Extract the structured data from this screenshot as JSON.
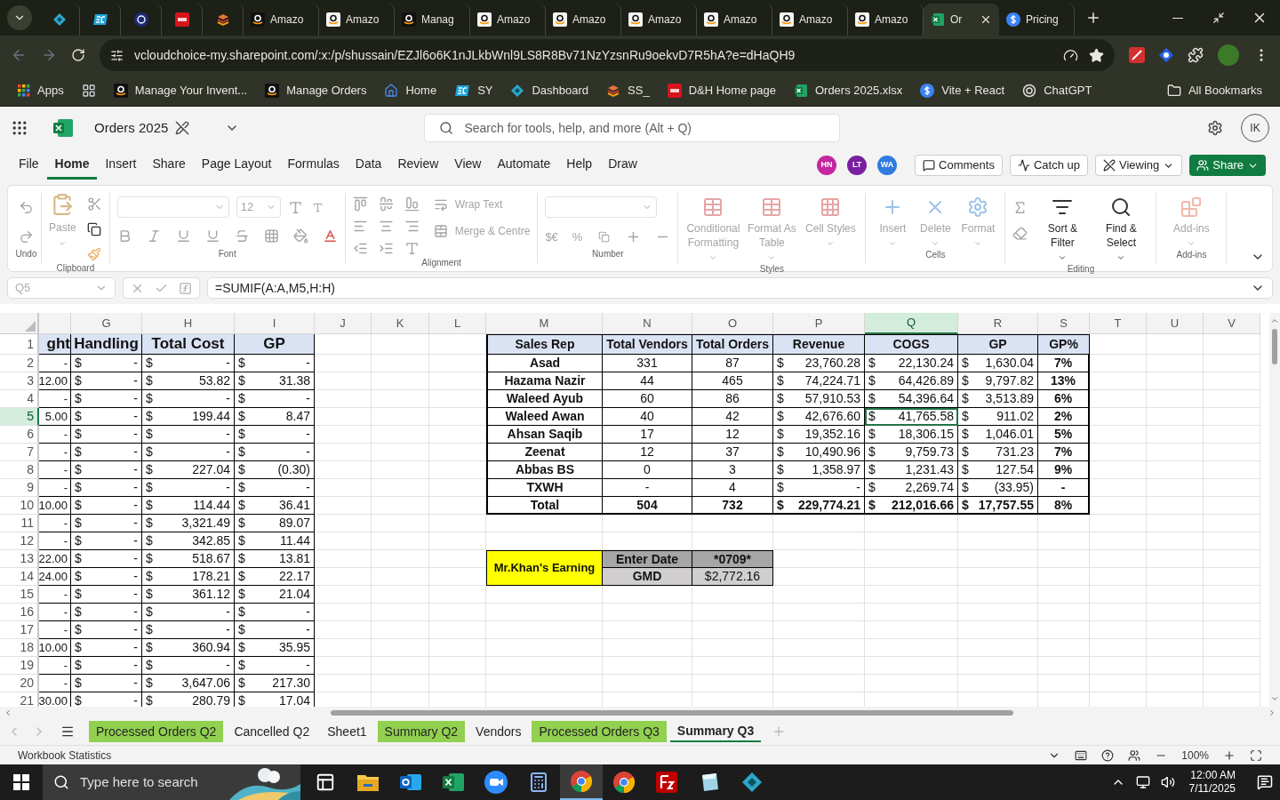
{
  "browser": {
    "tabs": [
      {
        "kind": "diamond",
        "selected": false
      },
      {
        "kind": "ec",
        "selected": false
      },
      {
        "kind": "tu",
        "selected": false
      },
      {
        "kind": "dh",
        "selected": false
      },
      {
        "kind": "stack",
        "selected": false
      },
      {
        "kind": "amazon",
        "label": "Amazo",
        "selected": false
      },
      {
        "kind": "amazon-light",
        "label": "Amazo",
        "selected": false
      },
      {
        "kind": "amazon",
        "label": "Manag",
        "selected": false
      },
      {
        "kind": "amazon-light",
        "label": "Amazo",
        "selected": false
      },
      {
        "kind": "amazon-light",
        "label": "Amazo",
        "selected": false
      },
      {
        "kind": "amazon-light",
        "label": "Amazo",
        "selected": false
      },
      {
        "kind": "amazon-light",
        "label": "Amazo",
        "selected": false
      },
      {
        "kind": "amazon-light",
        "label": "Amazo",
        "selected": false
      },
      {
        "kind": "amazon-light",
        "label": "Amazo",
        "selected": false
      },
      {
        "kind": "excel",
        "label": "Or",
        "selected": true
      },
      {
        "kind": "dollar",
        "label": "Pricing",
        "selected": false
      }
    ],
    "url": "vcloudchoice-my.sharepoint.com/:x:/p/shussain/EZJl6o6K1nJLkbWnl9LS8R8Bv71NzYzsnRu9oekvD7R5hA?e=dHaQH9",
    "bookmarks": [
      {
        "kind": "apps",
        "label": "Apps"
      },
      {
        "kind": "grid"
      },
      {
        "kind": "amazon",
        "label": "Manage Your Invent..."
      },
      {
        "kind": "amazon",
        "label": "Manage Orders"
      },
      {
        "kind": "home",
        "label": "Home"
      },
      {
        "kind": "ec",
        "label": "SY"
      },
      {
        "kind": "diamond",
        "label": "Dashboard"
      },
      {
        "kind": "stack",
        "label": "SS_"
      },
      {
        "kind": "dh",
        "label": "D&H Home page"
      },
      {
        "kind": "excel",
        "label": "Orders 2025.xlsx"
      },
      {
        "kind": "dollar",
        "label": "Vite + React"
      },
      {
        "kind": "chatgpt",
        "label": "ChatGPT"
      }
    ],
    "all_bookmarks": "All Bookmarks"
  },
  "excel": {
    "file_name": "Orders 2025",
    "search_placeholder": "Search for tools, help, and more (Alt + Q)",
    "user_initials": "IK",
    "menu": [
      {
        "label": "File",
        "selected": false
      },
      {
        "label": "Home",
        "selected": true
      },
      {
        "label": "Insert",
        "selected": false
      },
      {
        "label": "Share",
        "selected": false
      },
      {
        "label": "Page Layout",
        "selected": false
      },
      {
        "label": "Formulas",
        "selected": false
      },
      {
        "label": "Data",
        "selected": false
      },
      {
        "label": "Review",
        "selected": false
      },
      {
        "label": "View",
        "selected": false
      },
      {
        "label": "Automate",
        "selected": false
      },
      {
        "label": "Help",
        "selected": false
      },
      {
        "label": "Draw",
        "selected": false
      }
    ],
    "collaborators": [
      {
        "initials": "HN",
        "color": "#c4269f"
      },
      {
        "initials": "LT",
        "color": "#7a1fa2"
      },
      {
        "initials": "WA",
        "color": "#2f7be0"
      }
    ],
    "actions": {
      "comments": "Comments",
      "catch_up": "Catch up",
      "viewing": "Viewing",
      "share": "Share"
    },
    "ribbon": [
      {
        "kind": "undo",
        "label": "Undo"
      },
      {
        "kind": "clipboard",
        "label": "Clipboard",
        "commands": [
          {
            "label": "Paste",
            "disabled": true
          }
        ]
      },
      {
        "kind": "font",
        "label": "Font",
        "font_size": "12"
      },
      {
        "kind": "alignment",
        "label": "Alignment",
        "commands": [
          {
            "label": "Wrap Text",
            "disabled": true
          },
          {
            "label": "Merge & Centre",
            "disabled": true
          }
        ]
      },
      {
        "kind": "number",
        "label": "Number",
        "commands": [
          {
            "label": "$€",
            "disabled": true
          },
          {
            "label": "%",
            "disabled": true
          }
        ]
      },
      {
        "kind": "styles",
        "label": "Styles",
        "commands": [
          {
            "label": "Conditional Formatting",
            "disabled": true
          },
          {
            "label": "Format As Table",
            "disabled": true
          },
          {
            "label": "Cell Styles",
            "disabled": true
          }
        ]
      },
      {
        "kind": "cells",
        "label": "Cells",
        "commands": [
          {
            "label": "Insert",
            "disabled": true
          },
          {
            "label": "Delete",
            "disabled": true
          },
          {
            "label": "Format",
            "disabled": true
          }
        ]
      },
      {
        "kind": "editing",
        "label": "Editing",
        "commands": [
          {
            "label": "Sort & Filter",
            "disabled": false
          },
          {
            "label": "Find & Select",
            "disabled": false
          }
        ]
      },
      {
        "kind": "addins",
        "label": "Add-ins",
        "commands": [
          {
            "label": "Add-ins",
            "disabled": true
          }
        ]
      }
    ],
    "name_box": "Q5",
    "formula": "=SUMIF(A:A,M5,H:H)"
  },
  "grid": {
    "columns": [
      {
        "label": "G",
        "selected": false
      },
      {
        "label": "H",
        "selected": false
      },
      {
        "label": "I",
        "selected": false
      },
      {
        "label": "J",
        "selected": false
      },
      {
        "label": "K",
        "selected": false
      },
      {
        "label": "L",
        "selected": false
      },
      {
        "label": "M",
        "selected": false
      },
      {
        "label": "N",
        "selected": false
      },
      {
        "label": "O",
        "selected": false
      },
      {
        "label": "P",
        "selected": false
      },
      {
        "label": "Q",
        "selected": true
      },
      {
        "label": "R",
        "selected": false
      },
      {
        "label": "S",
        "selected": false
      },
      {
        "label": "T",
        "selected": false
      },
      {
        "label": "U",
        "selected": false
      },
      {
        "label": "V",
        "selected": false
      }
    ],
    "rows": [
      {
        "label": "1",
        "selected": false
      },
      {
        "label": "2",
        "selected": false
      },
      {
        "label": "3",
        "selected": false
      },
      {
        "label": "4",
        "selected": false
      },
      {
        "label": "5",
        "selected": true
      },
      {
        "label": "6",
        "selected": false
      },
      {
        "label": "7",
        "selected": false
      },
      {
        "label": "8",
        "selected": false
      },
      {
        "label": "9",
        "selected": false
      },
      {
        "label": "10",
        "selected": false
      },
      {
        "label": "11",
        "selected": false
      },
      {
        "label": "12",
        "selected": false
      },
      {
        "label": "13",
        "selected": false
      },
      {
        "label": "14",
        "selected": false
      },
      {
        "label": "15",
        "selected": false
      },
      {
        "label": "16",
        "selected": false
      },
      {
        "label": "17",
        "selected": false
      },
      {
        "label": "18",
        "selected": false
      },
      {
        "label": "19",
        "selected": false
      },
      {
        "label": "20",
        "selected": false
      },
      {
        "label": "21",
        "selected": false
      }
    ]
  },
  "cost_table": {
    "header": [
      "ght",
      "Handling",
      "Total Cost",
      "GP"
    ],
    "rows": [
      [
        {
          "v": "-"
        },
        {
          "s": "$",
          "v": "-"
        },
        {
          "s": "$",
          "v": "-"
        },
        {
          "s": "$",
          "v": "-"
        }
      ],
      [
        {
          "v": "12.00"
        },
        {
          "s": "$",
          "v": "-"
        },
        {
          "s": "$",
          "v": "53.82"
        },
        {
          "s": "$",
          "v": "31.38"
        }
      ],
      [
        {
          "v": "-"
        },
        {
          "s": "$",
          "v": "-"
        },
        {
          "s": "$",
          "v": "-"
        },
        {
          "s": "$",
          "v": "-"
        }
      ],
      [
        {
          "v": "5.00"
        },
        {
          "s": "$",
          "v": "-"
        },
        {
          "s": "$",
          "v": "199.44"
        },
        {
          "s": "$",
          "v": "8.47"
        }
      ],
      [
        {
          "v": "-"
        },
        {
          "s": "$",
          "v": "-"
        },
        {
          "s": "$",
          "v": "-"
        },
        {
          "s": "$",
          "v": "-"
        }
      ],
      [
        {
          "v": "-"
        },
        {
          "s": "$",
          "v": "-"
        },
        {
          "s": "$",
          "v": "-"
        },
        {
          "s": "$",
          "v": "-"
        }
      ],
      [
        {
          "v": "-"
        },
        {
          "s": "$",
          "v": "-"
        },
        {
          "s": "$",
          "v": "227.04"
        },
        {
          "s": "$",
          "v": "(0.30)"
        }
      ],
      [
        {
          "v": "-"
        },
        {
          "s": "$",
          "v": "-"
        },
        {
          "s": "$",
          "v": "-"
        },
        {
          "s": "$",
          "v": "-"
        }
      ],
      [
        {
          "v": "10.00"
        },
        {
          "s": "$",
          "v": "-"
        },
        {
          "s": "$",
          "v": "114.44"
        },
        {
          "s": "$",
          "v": "36.41"
        }
      ],
      [
        {
          "v": "-"
        },
        {
          "s": "$",
          "v": "-"
        },
        {
          "s": "$",
          "v": "3,321.49"
        },
        {
          "s": "$",
          "v": "89.07"
        }
      ],
      [
        {
          "v": "-"
        },
        {
          "s": "$",
          "v": "-"
        },
        {
          "s": "$",
          "v": "342.85"
        },
        {
          "s": "$",
          "v": "11.44"
        }
      ],
      [
        {
          "v": "22.00"
        },
        {
          "s": "$",
          "v": "-"
        },
        {
          "s": "$",
          "v": "518.67"
        },
        {
          "s": "$",
          "v": "13.81"
        }
      ],
      [
        {
          "v": "24.00"
        },
        {
          "s": "$",
          "v": "-"
        },
        {
          "s": "$",
          "v": "178.21"
        },
        {
          "s": "$",
          "v": "22.17"
        }
      ],
      [
        {
          "v": "-"
        },
        {
          "s": "$",
          "v": "-"
        },
        {
          "s": "$",
          "v": "361.12"
        },
        {
          "s": "$",
          "v": "21.04"
        }
      ],
      [
        {
          "v": "-"
        },
        {
          "s": "$",
          "v": "-"
        },
        {
          "s": "$",
          "v": "-"
        },
        {
          "s": "$",
          "v": "-"
        }
      ],
      [
        {
          "v": "-"
        },
        {
          "s": "$",
          "v": "-"
        },
        {
          "s": "$",
          "v": "-"
        },
        {
          "s": "$",
          "v": "-"
        }
      ],
      [
        {
          "v": "10.00"
        },
        {
          "s": "$",
          "v": "-"
        },
        {
          "s": "$",
          "v": "360.94"
        },
        {
          "s": "$",
          "v": "35.95"
        }
      ],
      [
        {
          "v": "-"
        },
        {
          "s": "$",
          "v": "-"
        },
        {
          "s": "$",
          "v": "-"
        },
        {
          "s": "$",
          "v": "-"
        }
      ],
      [
        {
          "v": "-"
        },
        {
          "s": "$",
          "v": "-"
        },
        {
          "s": "$",
          "v": "3,647.06"
        },
        {
          "s": "$",
          "v": "217.30"
        }
      ],
      [
        {
          "v": "30.00"
        },
        {
          "s": "$",
          "v": "-"
        },
        {
          "s": "$",
          "v": "280.79"
        },
        {
          "s": "$",
          "v": "17.04"
        }
      ]
    ]
  },
  "summary_table": {
    "header": [
      "Sales Rep",
      "Total Vendors",
      "Total Orders",
      "Revenue",
      "COGS",
      "GP",
      "GP%"
    ],
    "rows": [
      {
        "kind": "rep",
        "cells": [
          {
            "v": "Asad"
          },
          {
            "v": "331"
          },
          {
            "v": "87"
          },
          {
            "s": "$",
            "v": "23,760.28"
          },
          {
            "s": "$",
            "v": "22,130.24"
          },
          {
            "s": "$",
            "v": "1,630.04"
          },
          {
            "v": "7%"
          }
        ]
      },
      {
        "kind": "rep",
        "cells": [
          {
            "v": "Hazama Nazir"
          },
          {
            "v": "44"
          },
          {
            "v": "465"
          },
          {
            "s": "$",
            "v": "74,224.71"
          },
          {
            "s": "$",
            "v": "64,426.89"
          },
          {
            "s": "$",
            "v": "9,797.82"
          },
          {
            "v": "13%"
          }
        ]
      },
      {
        "kind": "rep",
        "cells": [
          {
            "v": "Waleed Ayub"
          },
          {
            "v": "60"
          },
          {
            "v": "86"
          },
          {
            "s": "$",
            "v": "57,910.53"
          },
          {
            "s": "$",
            "v": "54,396.64"
          },
          {
            "s": "$",
            "v": "3,513.89"
          },
          {
            "v": "6%"
          }
        ]
      },
      {
        "kind": "rep",
        "cells": [
          {
            "v": "Waleed Awan"
          },
          {
            "v": "40"
          },
          {
            "v": "42"
          },
          {
            "s": "$",
            "v": "42,676.60"
          },
          {
            "s": "$",
            "v": "41,765.58"
          },
          {
            "s": "$",
            "v": "911.02"
          },
          {
            "v": "2%"
          }
        ]
      },
      {
        "kind": "rep",
        "cells": [
          {
            "v": "Ahsan Saqib"
          },
          {
            "v": "17"
          },
          {
            "v": "12"
          },
          {
            "s": "$",
            "v": "19,352.16"
          },
          {
            "s": "$",
            "v": "18,306.15"
          },
          {
            "s": "$",
            "v": "1,046.01"
          },
          {
            "v": "5%"
          }
        ]
      },
      {
        "kind": "rep",
        "cells": [
          {
            "v": "Zeenat"
          },
          {
            "v": "12"
          },
          {
            "v": "37"
          },
          {
            "s": "$",
            "v": "10,490.96"
          },
          {
            "s": "$",
            "v": "9,759.73"
          },
          {
            "s": "$",
            "v": "731.23"
          },
          {
            "v": "7%"
          }
        ]
      },
      {
        "kind": "rep",
        "cells": [
          {
            "v": "Abbas BS"
          },
          {
            "v": "0"
          },
          {
            "v": "3"
          },
          {
            "s": "$",
            "v": "1,358.97"
          },
          {
            "s": "$",
            "v": "1,231.43"
          },
          {
            "s": "$",
            "v": "127.54"
          },
          {
            "v": "9%"
          }
        ]
      },
      {
        "kind": "rep",
        "cells": [
          {
            "v": "TXWH"
          },
          {
            "v": "-"
          },
          {
            "v": "4"
          },
          {
            "s": "$",
            "v": "-"
          },
          {
            "s": "$",
            "v": "2,269.74"
          },
          {
            "s": "$",
            "v": "(33.95)"
          },
          {
            "v": "-"
          }
        ]
      },
      {
        "kind": "total",
        "cells": [
          {
            "v": "Total"
          },
          {
            "v": "504"
          },
          {
            "v": "732"
          },
          {
            "s": "$",
            "v": "229,774.21"
          },
          {
            "s": "$",
            "v": "212,016.66"
          },
          {
            "s": "$",
            "v": "17,757.55"
          },
          {
            "v": "8%"
          }
        ]
      }
    ]
  },
  "earning_table": {
    "title": "Mr.Khan's Earning",
    "rows": [
      [
        "Enter Date",
        "*0709*"
      ],
      [
        "GMD",
        "$2,772.16"
      ]
    ]
  },
  "sheet_tabs": [
    {
      "label": "Processed Orders Q2",
      "color": "#92d050",
      "selected": false
    },
    {
      "label": "Cancelled Q2",
      "selected": false
    },
    {
      "label": "Sheet1",
      "selected": false
    },
    {
      "label": "Summary Q2",
      "color": "#92d050",
      "selected": false
    },
    {
      "label": "Vendors",
      "selected": false
    },
    {
      "label": "Processed Orders Q3",
      "color": "#92d050",
      "selected": false
    },
    {
      "label": "Summary Q3",
      "selected": true
    }
  ],
  "status_bar": {
    "left": "Workbook Statistics",
    "zoom": "100%"
  },
  "taskbar": {
    "search_placeholder": "Type here to search",
    "apps": [
      {
        "kind": "task-view",
        "selected": false
      },
      {
        "kind": "folder",
        "selected": false
      },
      {
        "kind": "outlook",
        "selected": false
      },
      {
        "kind": "excel",
        "selected": false
      },
      {
        "kind": "zoom",
        "selected": false
      },
      {
        "kind": "calculator",
        "selected": false
      },
      {
        "kind": "chrome",
        "selected": true
      },
      {
        "kind": "chrome",
        "selected": false
      },
      {
        "kind": "filezilla",
        "selected": false
      },
      {
        "kind": "notes",
        "selected": false
      },
      {
        "kind": "diamond",
        "selected": false
      }
    ],
    "time": "12:00 AM",
    "date": "7/11/2025"
  }
}
